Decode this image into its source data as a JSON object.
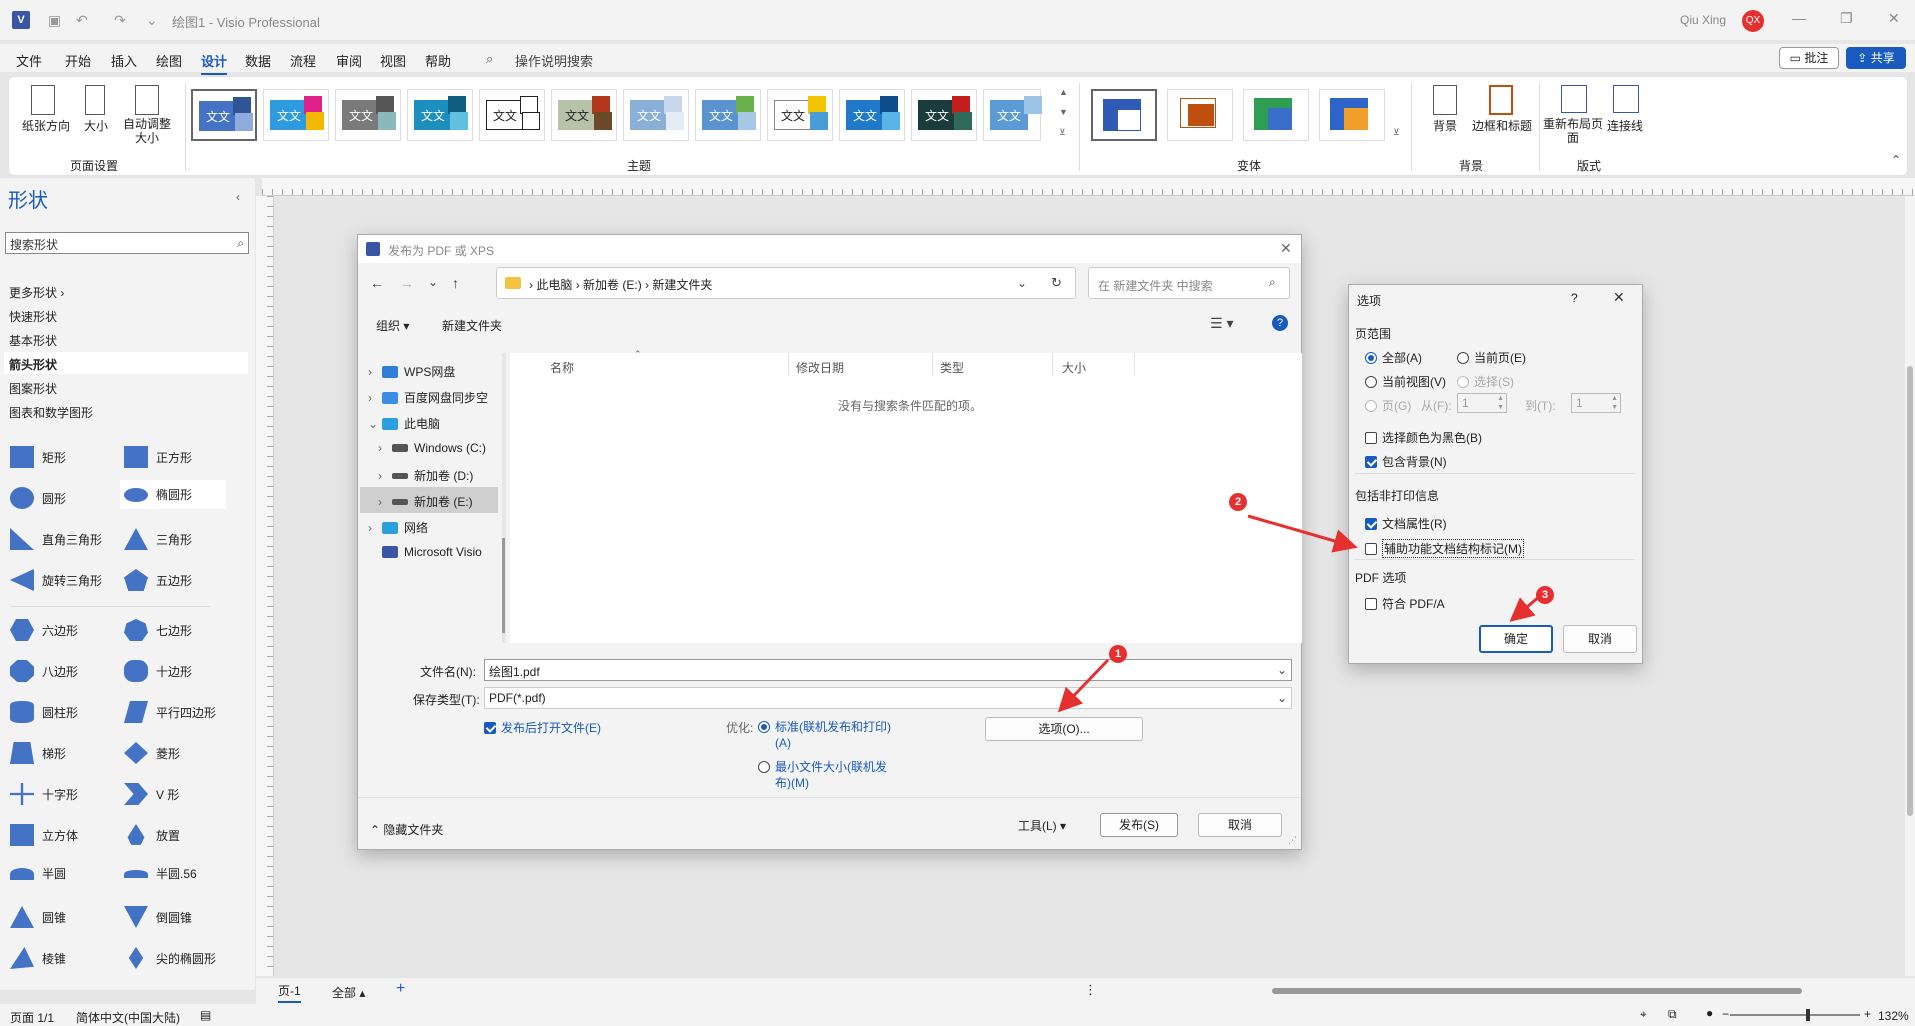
{
  "app": {
    "doc_title": "绘图1 - Visio Professional",
    "user": "Qiu Xing",
    "user_initials": "QX",
    "comment_btn": "批注",
    "share_btn": "共享"
  },
  "menu": [
    "文件",
    "开始",
    "插入",
    "绘图",
    "设计",
    "数据",
    "流程",
    "审阅",
    "视图",
    "帮助"
  ],
  "menu_search": "操作说明搜索",
  "ribbon": {
    "page_setup": {
      "items": [
        "纸张方向",
        "大小",
        "自动调整大小"
      ],
      "label": "页面设置"
    },
    "themes_label": "主题",
    "theme_text": "文文",
    "variants_label": "变体",
    "background": {
      "items": [
        "背景",
        "边框和标题"
      ],
      "label": "背景"
    },
    "layout": {
      "items": [
        "重新布局页面",
        "连接线"
      ],
      "label": "版式"
    }
  },
  "shapes": {
    "title": "形状",
    "search_placeholder": "搜索形状",
    "more": "更多形状",
    "categories": [
      "快速形状",
      "基本形状",
      "箭头形状",
      "图案形状",
      "图表和数学图形"
    ],
    "items": [
      [
        "矩形",
        "正方形"
      ],
      [
        "圆形",
        "椭圆形"
      ],
      [
        "直角三角形",
        "三角形"
      ],
      [
        "旋转三角形",
        "五边形"
      ],
      [
        "六边形",
        "七边形"
      ],
      [
        "八边形",
        "十边形"
      ],
      [
        "圆柱形",
        "平行四边形"
      ],
      [
        "梯形",
        "菱形"
      ],
      [
        "十字形",
        "V 形"
      ],
      [
        "立方体",
        "放置"
      ],
      [
        "半圆",
        "半圆.56"
      ],
      [
        "圆锥",
        "倒圆锥"
      ],
      [
        "棱锥",
        "尖的椭圆形"
      ]
    ]
  },
  "dialog_pdf": {
    "title": "发布为 PDF 或 XPS",
    "path": [
      "此电脑",
      "新加卷 (E:)",
      "新建文件夹"
    ],
    "search_placeholder": "在 新建文件夹 中搜索",
    "organize": "组织",
    "new_folder": "新建文件夹",
    "tree": [
      "WPS网盘",
      "百度网盘同步空",
      "此电脑",
      "Windows (C:)",
      "新加卷 (D:)",
      "新加卷 (E:)",
      "网络",
      "Microsoft Visio"
    ],
    "columns": [
      "名称",
      "修改日期",
      "类型",
      "大小"
    ],
    "empty_msg": "没有与搜索条件匹配的项。",
    "filename_label": "文件名(N):",
    "filename": "绘图1.pdf",
    "type_label": "保存类型(T):",
    "type_value": "PDF(*.pdf)",
    "open_after": "发布后打开文件(E)",
    "optimize_label": "优化:",
    "opt_standard": "标准(联机发布和打印)(A)",
    "opt_min": "最小文件大小(联机发布)(M)",
    "options_btn": "选项(O)...",
    "hide_folders": "隐藏文件夹",
    "tools": "工具(L)",
    "publish": "发布(S)",
    "cancel": "取消"
  },
  "dialog_opt": {
    "title": "选项",
    "help": "?",
    "range_label": "页范围",
    "all": "全部(A)",
    "current_page": "当前页(E)",
    "current_view": "当前视图(V)",
    "selection": "选择(S)",
    "pages": "页(G)",
    "from": "从(F):",
    "to": "到(T):",
    "from_val": "1",
    "to_val": "1",
    "bw": "选择颜色为黑色(B)",
    "include_bg": "包含背景(N)",
    "nonprint_label": "包括非打印信息",
    "doc_props": "文档属性(R)",
    "accessibility": "辅助功能文档结构标记(M)",
    "pdf_label": "PDF 选项",
    "pdfa": "符合 PDF/A",
    "ok": "确定",
    "cancel": "取消"
  },
  "markers": [
    "1",
    "2",
    "3"
  ],
  "tabs": {
    "page": "页-1",
    "all": "全部"
  },
  "status": {
    "page": "页面 1/1",
    "lang": "简体中文(中国大陆)",
    "zoom": "132%"
  },
  "colors": {
    "accent": "#185abd",
    "marker": "#e62f2f"
  }
}
